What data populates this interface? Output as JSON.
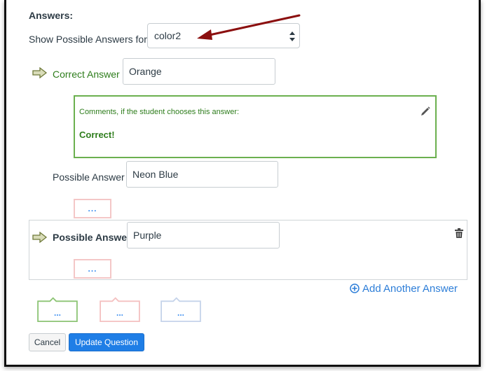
{
  "answers_section": {
    "heading": "Answers:",
    "show_label": "Show Possible Answers for",
    "selected_variable": "color2"
  },
  "correct_answer": {
    "label": "Correct Answer",
    "value": "Orange",
    "comment_hint": "Comments, if the student chooses this answer:",
    "comment_text": "Correct!"
  },
  "possible_answers": [
    {
      "label": "Possible Answer",
      "value": "Neon Blue",
      "comment_placeholder": "..."
    },
    {
      "label": "Possible Answer",
      "value": "Purple",
      "comment_placeholder": "..."
    }
  ],
  "add_answer_label": "Add Another Answer",
  "general_comments": [
    {
      "placeholder": "...",
      "type": "correct",
      "border_color": "#8cc474"
    },
    {
      "placeholder": "...",
      "type": "incorrect",
      "border_color": "#f4c0c0"
    },
    {
      "placeholder": "...",
      "type": "neutral",
      "border_color": "#c5d3ea"
    }
  ],
  "buttons": {
    "cancel": "Cancel",
    "update": "Update Question"
  },
  "colors": {
    "correct_green": "#2e7d1c",
    "link_blue": "#2d7ed8",
    "primary_button": "#1f7ee6",
    "annotation_arrow": "#8b0f0f"
  },
  "icons": {
    "answer_arrow": "arrow-right-icon",
    "edit": "pencil-icon",
    "delete": "trash-icon",
    "add": "plus-circle-icon",
    "select": "chevron-updown-icon"
  }
}
